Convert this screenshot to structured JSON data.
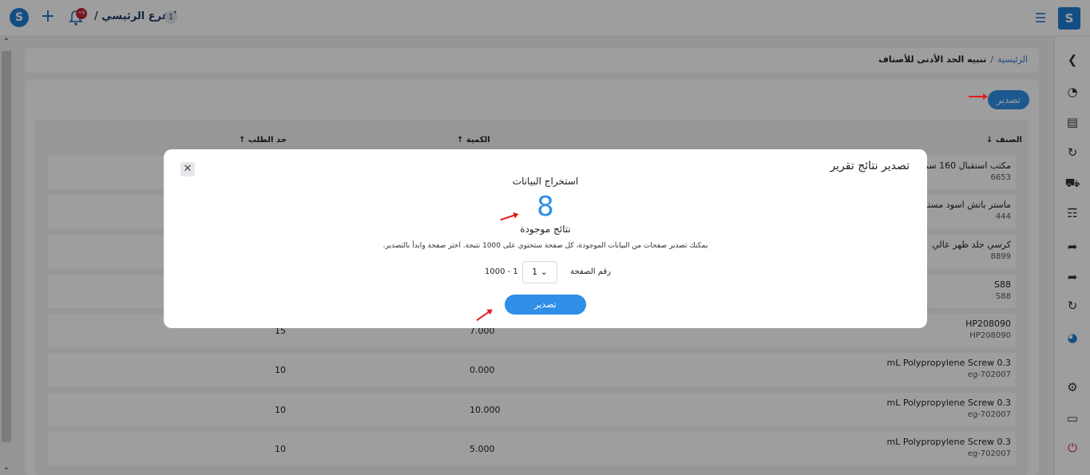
{
  "topbar": {
    "branch_label": "الفرع الرئيسي /",
    "branch_count": "1",
    "notif_badge": "+9"
  },
  "breadcrumb": {
    "home": "الرئيسية",
    "separator": "/",
    "current": "تنبيه الحد الأدنى للأصناف"
  },
  "export_button": "تصدير",
  "table": {
    "headers": {
      "item": "الصنف",
      "qty": "الكمية",
      "limit": "حد الطلب"
    },
    "rows": [
      {
        "name": "مكتب استقبال 160 سم",
        "code": "6653",
        "qty": "",
        "limit": ""
      },
      {
        "name": "ماستر باتش اسود مستورد",
        "code": "444",
        "qty": "",
        "limit": ""
      },
      {
        "name": "كرسي جلد ظهر عالي",
        "code": "8899",
        "qty": "",
        "limit": ""
      },
      {
        "name": "S88",
        "code": "S88",
        "qty": "",
        "limit": ""
      },
      {
        "name": "HP208090",
        "code": "HP208090",
        "qty": "7.000",
        "limit": "15"
      },
      {
        "name": "mL Polypropylene Screw 0.3",
        "code": "eg-702007",
        "qty": "0.000",
        "limit": "10"
      },
      {
        "name": "mL Polypropylene Screw 0.3",
        "code": "eg-702007",
        "qty": "10.000",
        "limit": "10"
      },
      {
        "name": "mL Polypropylene Screw 0.3",
        "code": "eg-702007",
        "qty": "5.000",
        "limit": "10"
      }
    ]
  },
  "modal": {
    "title": "تصدير نتائج تقرير",
    "heading": "استخراج البيانات",
    "count": "8",
    "found_label": "نتائج موجودة",
    "description": "يمكنك تصدير صفحات من البيانات الموجودة، كل صفحة ستحتوي على 1000 نتيجة. اختر صفحة وابدأ بالتصدير.",
    "page_label": "رقم الصفحة",
    "page_value": "1",
    "page_range": "1000 - 1",
    "export_label": "تصدير"
  },
  "colors": {
    "accent": "#2f8ee6",
    "brand": "#1f7fd4",
    "annotation_arrow": "#e21d1d"
  },
  "icons": {
    "sidebar": [
      "chevron-left-icon",
      "speedometer-icon",
      "inventory-icon",
      "refresh-icon",
      "truck-icon",
      "invoice-icon",
      "share-icon",
      "share-icon",
      "refresh-icon",
      "chart-icon",
      "gear-icon",
      "window-icon",
      "power-icon"
    ]
  }
}
